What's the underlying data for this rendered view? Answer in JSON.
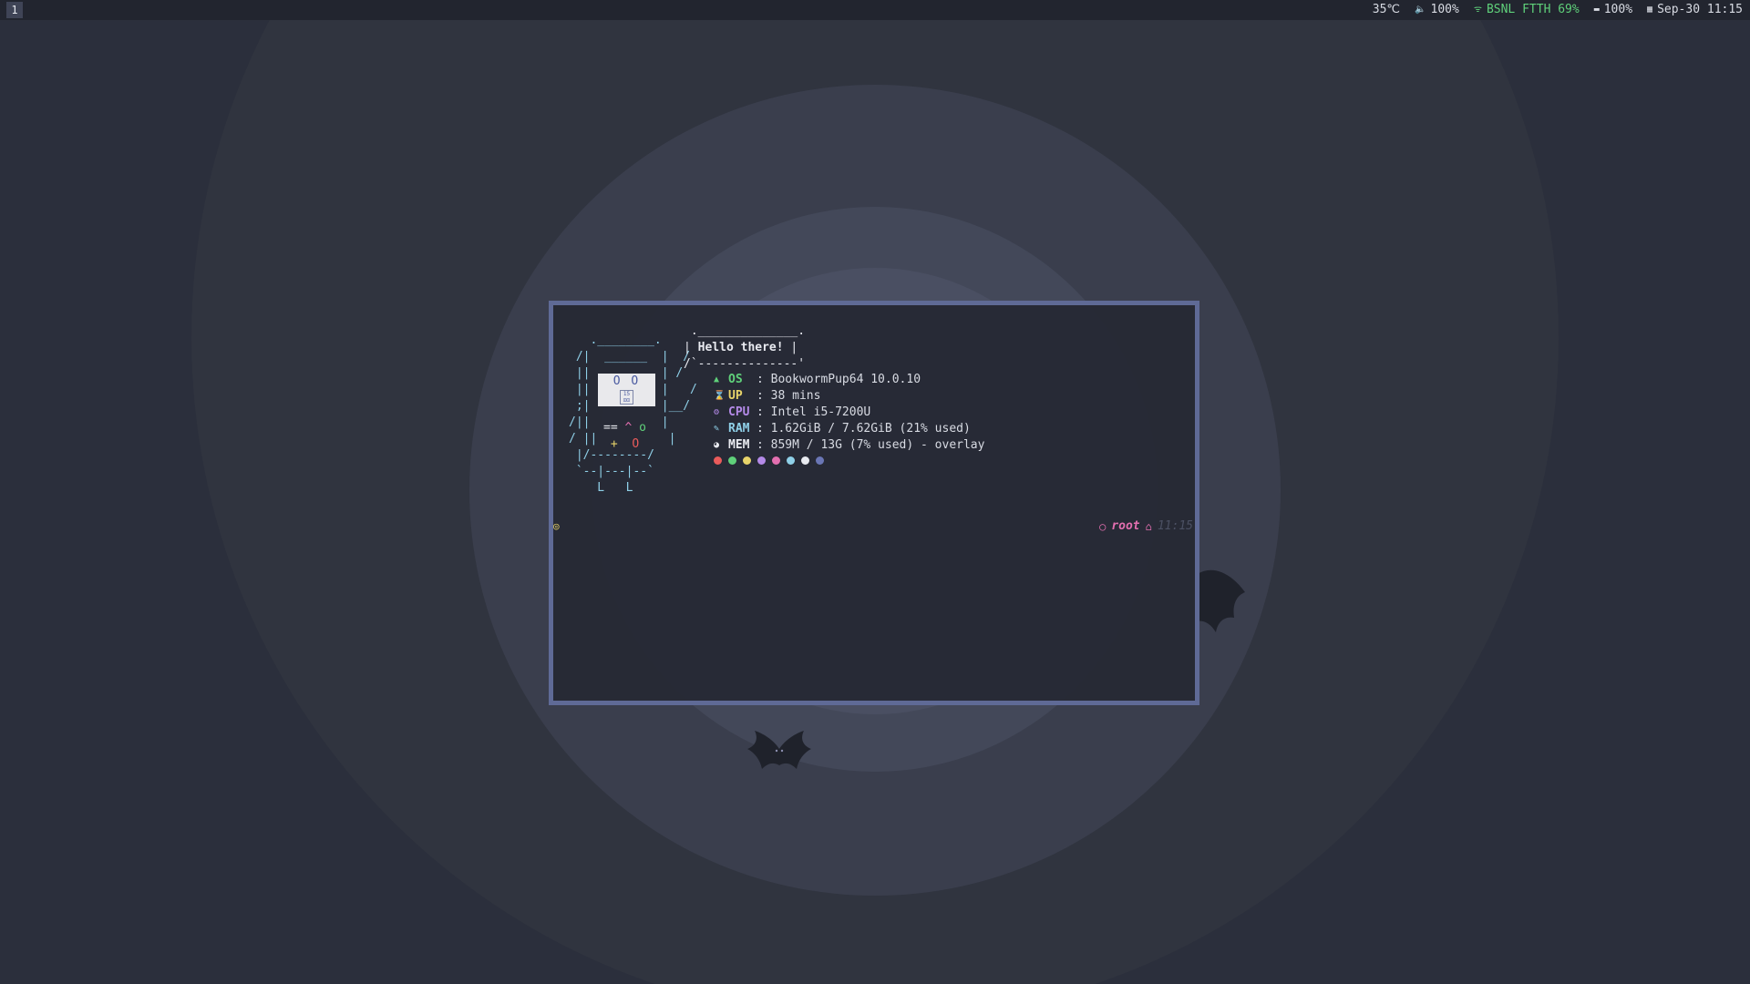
{
  "topbar": {
    "workspace": "1",
    "temperature": "35℃",
    "volume_icon": "speaker-icon",
    "volume": "100%",
    "wifi_icon": "wifi-icon",
    "wifi": "BSNL FTTH 69%",
    "battery_icon": "battery-icon",
    "battery": "100%",
    "calendar_icon": "calendar-icon",
    "datetime": "Sep-30 11:15"
  },
  "terminal": {
    "bubble_text": "Hello there!",
    "robot_eyes": "O O",
    "robot_chip": "15 ⊡⊡",
    "face": {
      "mouth": "==",
      "caret": "^",
      "small_o": "o",
      "plus": "+",
      "big_o": "O"
    },
    "sysinfo": [
      {
        "icon": "arrow-up-icon",
        "key": "OS",
        "value": "BookwormPup64 10.0.10"
      },
      {
        "icon": "hourglass-icon",
        "key": "UP",
        "value": "38 mins"
      },
      {
        "icon": "cpu-icon",
        "key": "CPU",
        "value": "Intel i5-7200U"
      },
      {
        "icon": "ram-icon",
        "key": "RAM",
        "value": "1.62GiB / 7.62GiB (21% used)"
      },
      {
        "icon": "disk-icon",
        "key": "MEM",
        "value": "859M / 13G (7% used) - overlay"
      }
    ],
    "palette": [
      "#ea5b5b",
      "#5fd07a",
      "#e8d46a",
      "#b48ae8",
      "#e36fb0",
      "#8fd0e8",
      "#e8eaf0",
      "#6a76b5"
    ],
    "prompt": {
      "left_icon": "spiral-icon",
      "user": "root",
      "time": "11:15"
    }
  },
  "colors": {
    "background": "#2b2f3c",
    "terminal_border": "#5f6a96",
    "accent_green": "#5fd07a",
    "accent_pink": "#e36fb0"
  }
}
